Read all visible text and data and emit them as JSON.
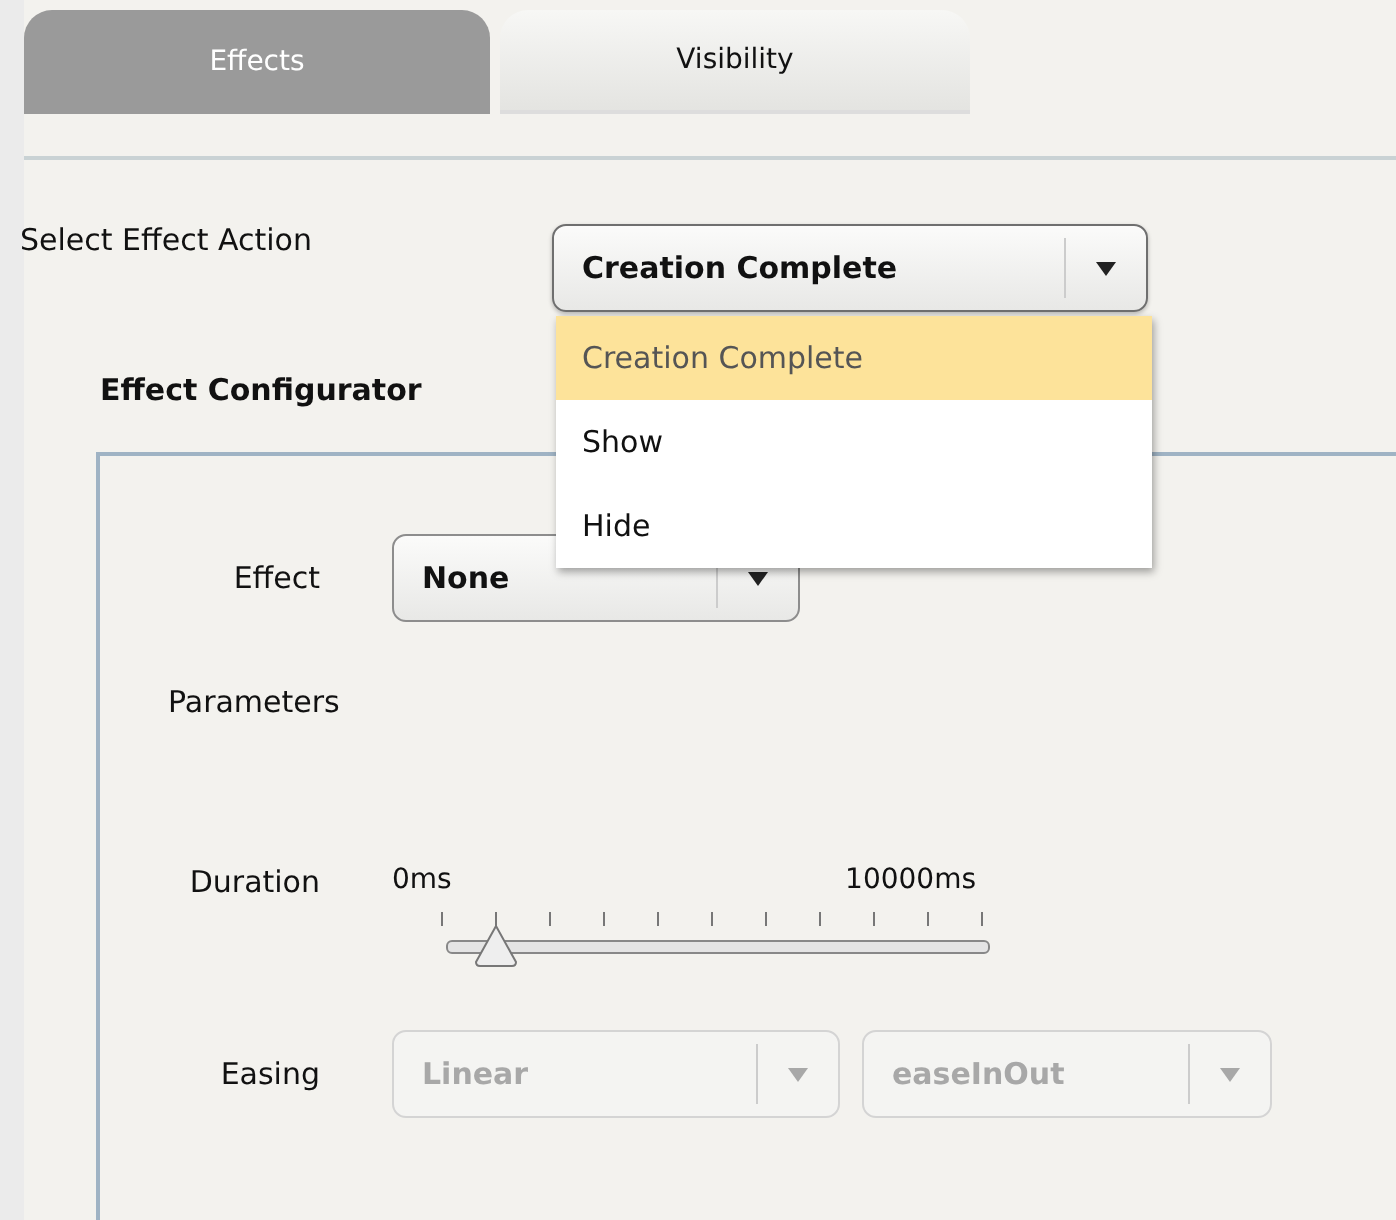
{
  "tabs": [
    {
      "label": "Effects",
      "selected": true
    },
    {
      "label": "Visibility",
      "selected": false
    }
  ],
  "action": {
    "label": "Select Effect Action",
    "value": "Creation Complete",
    "expanded": true,
    "options": [
      {
        "label": "Creation Complete",
        "selected": true
      },
      {
        "label": "Show",
        "selected": false
      },
      {
        "label": "Hide",
        "selected": false
      }
    ]
  },
  "configurator": {
    "title": "Effect Configurator",
    "effect_label": "Effect",
    "effect_value": "None",
    "parameters_label": "Parameters",
    "duration": {
      "label": "Duration",
      "min": "0ms",
      "max": "10000ms",
      "level": 0.09
    },
    "easing": {
      "label": "Easing",
      "disabled": true,
      "values": [
        "Linear",
        "easeInOut"
      ]
    }
  }
}
